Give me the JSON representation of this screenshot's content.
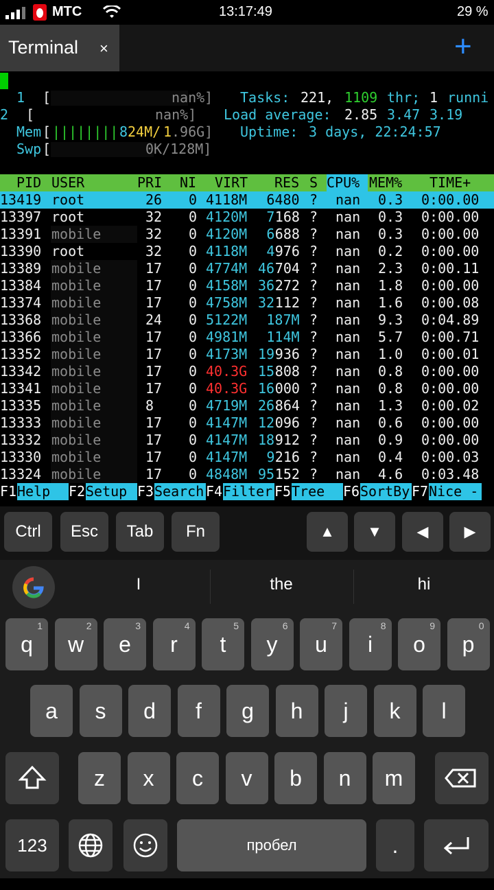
{
  "status_bar": {
    "carrier": "МТС",
    "time": "13:17:49",
    "battery": "29 %",
    "icons": [
      "signal-icon",
      "mts-logo-icon",
      "wifi-icon"
    ]
  },
  "tabs": [
    {
      "label": "Terminal",
      "close": "×",
      "active": true
    }
  ],
  "new_tab_label": "+",
  "htop": {
    "cpu1": {
      "num": "1",
      "bracket_open": "[",
      "value": "nan%]"
    },
    "cpu2": {
      "num": "2",
      "bracket_open": "[",
      "value": "nan%]"
    },
    "mem": {
      "label": "Mem",
      "bracket_open": "[",
      "bars": "||||||||",
      "used": "824M",
      "sep": "/",
      "total_a": "1",
      "total_b": ".96G]"
    },
    "swp": {
      "label": "Swp",
      "bracket_open": "[",
      "value": "0K/128M]"
    },
    "tasks": {
      "label": "Tasks:",
      "count": "221,",
      "thr": "1109",
      "thr_label": "thr;",
      "running_count": "1",
      "running_label": "runni"
    },
    "load": {
      "label": "Load average:",
      "v1": "2.85",
      "v2": "3.47",
      "v3": "3.19"
    },
    "uptime": {
      "label": "Uptime:",
      "value": "3 days, 22:24:57"
    },
    "columns": [
      "PID",
      "USER",
      "PRI",
      "NI",
      "VIRT",
      "RES",
      "S",
      "CPU%",
      "MEM%",
      "TIME+"
    ],
    "rows": [
      {
        "pid": "13419",
        "user": "root",
        "pri": "26",
        "ni": "0",
        "virt": "4118M",
        "res_a": "",
        "res_b": "6480",
        "s": "?",
        "cpu": "nan",
        "mem": "0.3",
        "time": "0:00.00",
        "selected": true
      },
      {
        "pid": "13397",
        "user": "root",
        "pri": "32",
        "ni": "0",
        "virt": "4120M",
        "res_a": "7",
        "res_b": "168",
        "s": "?",
        "cpu": "nan",
        "mem": "0.3",
        "time": "0:00.00"
      },
      {
        "pid": "13391",
        "user": "mobile",
        "pri": "32",
        "ni": "0",
        "virt": "4120M",
        "res_a": "6",
        "res_b": "688",
        "s": "?",
        "cpu": "nan",
        "mem": "0.3",
        "time": "0:00.00"
      },
      {
        "pid": "13390",
        "user": "root",
        "pri": "32",
        "ni": "0",
        "virt": "4118M",
        "res_a": "4",
        "res_b": "976",
        "s": "?",
        "cpu": "nan",
        "mem": "0.2",
        "time": "0:00.00"
      },
      {
        "pid": "13389",
        "user": "mobile",
        "pri": "17",
        "ni": "0",
        "virt": "4774M",
        "res_a": "46",
        "res_b": "704",
        "s": "?",
        "cpu": "nan",
        "mem": "2.3",
        "time": "0:00.11"
      },
      {
        "pid": "13384",
        "user": "mobile",
        "pri": "17",
        "ni": "0",
        "virt": "4158M",
        "res_a": "36",
        "res_b": "272",
        "s": "?",
        "cpu": "nan",
        "mem": "1.8",
        "time": "0:00.00"
      },
      {
        "pid": "13374",
        "user": "mobile",
        "pri": "17",
        "ni": "0",
        "virt": "4758M",
        "res_a": "32",
        "res_b": "112",
        "s": "?",
        "cpu": "nan",
        "mem": "1.6",
        "time": "0:00.08"
      },
      {
        "pid": "13368",
        "user": "mobile",
        "pri": "24",
        "ni": "0",
        "virt": "5122M",
        "res_a": "187M",
        "res_b": "",
        "s": "?",
        "cpu": "nan",
        "mem": "9.3",
        "time": "0:04.89"
      },
      {
        "pid": "13366",
        "user": "mobile",
        "pri": "17",
        "ni": "0",
        "virt": "4981M",
        "res_a": "114M",
        "res_b": "",
        "s": "?",
        "cpu": "nan",
        "mem": "5.7",
        "time": "0:00.71"
      },
      {
        "pid": "13352",
        "user": "mobile",
        "pri": "17",
        "ni": "0",
        "virt": "4173M",
        "res_a": "19",
        "res_b": "936",
        "s": "?",
        "cpu": "nan",
        "mem": "1.0",
        "time": "0:00.01"
      },
      {
        "pid": "13342",
        "user": "mobile",
        "pri": "17",
        "ni": "0",
        "virt": "40.3G",
        "virt_red": true,
        "res_a": "15",
        "res_b": "808",
        "s": "?",
        "cpu": "nan",
        "mem": "0.8",
        "time": "0:00.00"
      },
      {
        "pid": "13341",
        "user": "mobile",
        "pri": "17",
        "ni": "0",
        "virt": "40.3G",
        "virt_red": true,
        "res_a": "16",
        "res_b": "000",
        "s": "?",
        "cpu": "nan",
        "mem": "0.8",
        "time": "0:00.00"
      },
      {
        "pid": "13335",
        "user": "mobile",
        "pri": "8",
        "ni": "0",
        "virt": "4719M",
        "res_a": "26",
        "res_b": "864",
        "s": "?",
        "cpu": "nan",
        "mem": "1.3",
        "time": "0:00.02"
      },
      {
        "pid": "13333",
        "user": "mobile",
        "pri": "17",
        "ni": "0",
        "virt": "4147M",
        "res_a": "12",
        "res_b": "096",
        "s": "?",
        "cpu": "nan",
        "mem": "0.6",
        "time": "0:00.00"
      },
      {
        "pid": "13332",
        "user": "mobile",
        "pri": "17",
        "ni": "0",
        "virt": "4147M",
        "res_a": "18",
        "res_b": "912",
        "s": "?",
        "cpu": "nan",
        "mem": "0.9",
        "time": "0:00.00"
      },
      {
        "pid": "13330",
        "user": "mobile",
        "pri": "17",
        "ni": "0",
        "virt": "4147M",
        "res_a": "9",
        "res_b": "216",
        "s": "?",
        "cpu": "nan",
        "mem": "0.4",
        "time": "0:00.03"
      },
      {
        "pid": "13324",
        "user": "mobile",
        "pri": "17",
        "ni": "0",
        "virt": "4848M",
        "res_a": "95",
        "res_b": "152",
        "s": "?",
        "cpu": "nan",
        "mem": "4.6",
        "time": "0:03.48"
      }
    ],
    "fkeys": [
      {
        "num": "F1",
        "label": "Help  "
      },
      {
        "num": "F2",
        "label": "Setup "
      },
      {
        "num": "F3",
        "label": "Search"
      },
      {
        "num": "F4",
        "label": "Filter"
      },
      {
        "num": "F5",
        "label": "Tree  "
      },
      {
        "num": "F6",
        "label": "SortBy"
      },
      {
        "num": "F7",
        "label": "Nice -"
      }
    ]
  },
  "extra_keys": [
    "Ctrl",
    "Esc",
    "Tab",
    "Fn",
    "▲",
    "▼",
    "◀",
    "▶"
  ],
  "suggestions": [
    "I",
    "the",
    "hi"
  ],
  "keyboard": {
    "row1": [
      {
        "k": "q",
        "n": "1"
      },
      {
        "k": "w",
        "n": "2"
      },
      {
        "k": "e",
        "n": "3"
      },
      {
        "k": "r",
        "n": "4"
      },
      {
        "k": "t",
        "n": "5"
      },
      {
        "k": "y",
        "n": "6"
      },
      {
        "k": "u",
        "n": "7"
      },
      {
        "k": "i",
        "n": "8"
      },
      {
        "k": "o",
        "n": "9"
      },
      {
        "k": "p",
        "n": "0"
      }
    ],
    "row2": [
      "a",
      "s",
      "d",
      "f",
      "g",
      "h",
      "j",
      "k",
      "l"
    ],
    "row3": [
      "z",
      "x",
      "c",
      "v",
      "b",
      "n",
      "m"
    ],
    "numbers_key": "123",
    "space_label": "пробел",
    "period": "."
  },
  "colors": {
    "accent": "#2d8cff",
    "htop_cyan": "#2ec4e6",
    "htop_green": "#5fbf3f",
    "red": "#ff3030"
  }
}
